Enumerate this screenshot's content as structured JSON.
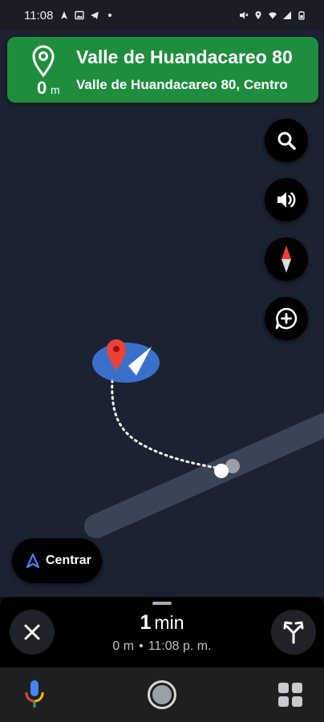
{
  "status_bar": {
    "time": "11:08",
    "icons": [
      "navigation-icon",
      "image-icon",
      "telegram-icon",
      "dot-icon",
      "mute-icon",
      "location-icon",
      "wifi-icon",
      "signal-icon",
      "battery-icon"
    ]
  },
  "banner": {
    "distance_value": "0",
    "distance_unit": "m",
    "street": "Valle de Huandacareo 80",
    "subtitle": "Valle de Huandacareo 80, Centro",
    "color": "#1e8e3e"
  },
  "map_buttons": [
    "search-icon",
    "volume-icon",
    "compass-icon",
    "add-report-icon"
  ],
  "recenter": {
    "label": "Centrar"
  },
  "trip": {
    "duration_value": "1",
    "duration_unit": "min",
    "distance": "0 m",
    "separator": "•",
    "arrival": "11:08 p. m."
  },
  "colors": {
    "map_bg": "#1b2231",
    "road": "#3a4454",
    "accent_blue": "#4285f4",
    "pin_red": "#ea4335"
  }
}
